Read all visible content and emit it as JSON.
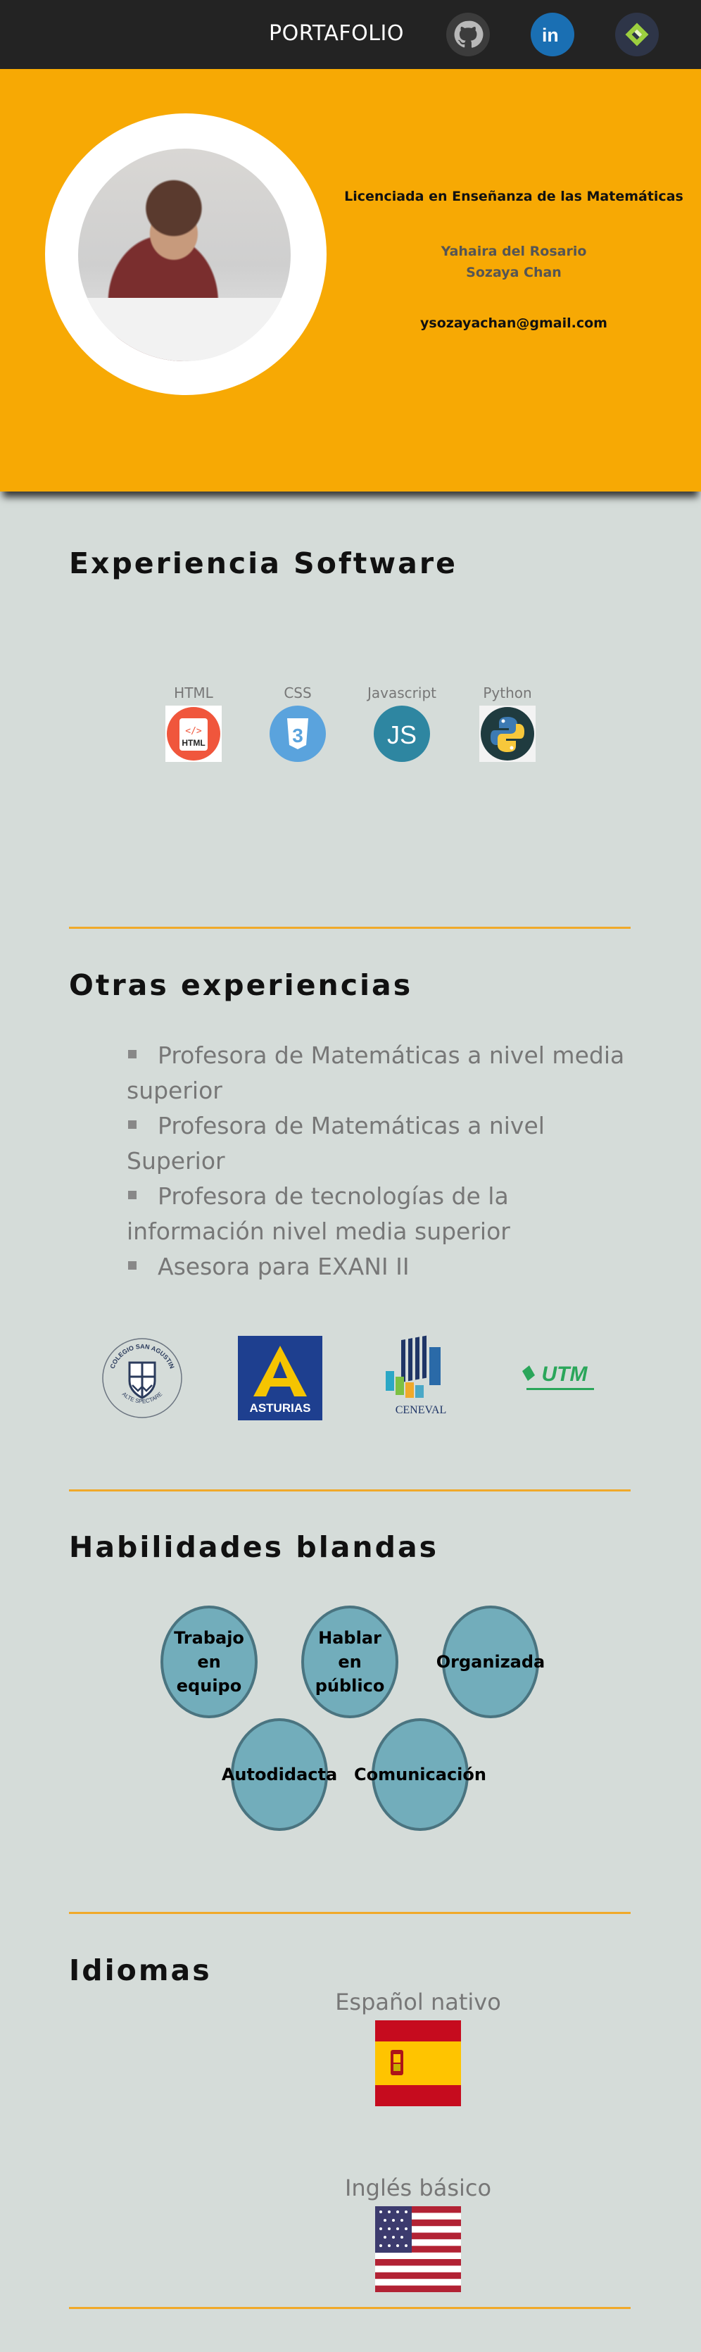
{
  "nav": {
    "title": "PORTAFOLIO",
    "icons": [
      "github-icon",
      "linkedin-icon",
      "freelancer-icon"
    ]
  },
  "hero": {
    "degree": "Licenciada en Enseñanza de las Matemáticas",
    "name_line1": "Yahaira del Rosario",
    "name_line2": "Sozaya Chan",
    "email": "ysozayachan@gmail.com"
  },
  "software": {
    "heading": "Experiencia Software",
    "items": [
      {
        "label": "HTML",
        "badge": "HTML",
        "icon": "html-icon"
      },
      {
        "label": "CSS",
        "badge": "3",
        "icon": "css-icon"
      },
      {
        "label": "Javascript",
        "badge": "JS",
        "icon": "javascript-icon"
      },
      {
        "label": "Python",
        "icon": "python-icon"
      }
    ]
  },
  "experience": {
    "heading": "Otras experiencias",
    "items": [
      "Profesora de Matemáticas a nivel media superior",
      "Profesora de Matemáticas a nivel Superior",
      "Profesora de tecnologías de la información nivel media superior",
      "Asesora para EXANI II"
    ],
    "logos": {
      "colegio_top": "COLEGIO SAN AGUSTIN",
      "colegio_bottom": "ALTE SPECTARE",
      "asturias": "ASTURIAS",
      "ceneval": "CENEVAL",
      "utm": "UTM"
    }
  },
  "soft_skills": {
    "heading": "Habilidades blandas",
    "items": [
      "Trabajo en equipo",
      "Hablar en público",
      "Organizada",
      "Autodidacta",
      "Comunicación"
    ]
  },
  "languages": {
    "heading": "Idiomas",
    "items": [
      {
        "label": "Español nativo",
        "flag": "spain-flag"
      },
      {
        "label": "Inglés básico",
        "flag": "usa-flag"
      }
    ]
  },
  "colors": {
    "accent": "#f7a904",
    "nav_bg": "#232323",
    "page_bg": "#d5dcd9",
    "bubble": "#72adbb"
  }
}
